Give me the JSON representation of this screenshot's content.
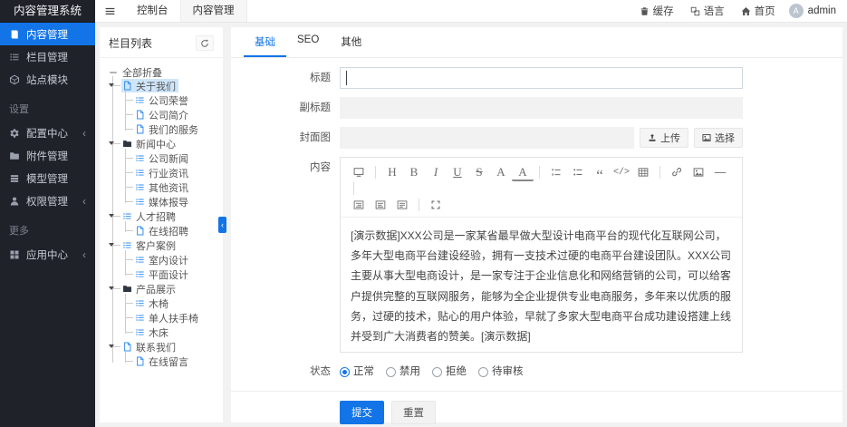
{
  "colors": {
    "primary": "#1274e7",
    "sidebar_bg": "#20222a",
    "tree_selected_bg": "#cfe6fa",
    "tree_icon_blue": "#2d8cf0",
    "folder_icon": "#2f3640"
  },
  "sidebar": {
    "title": "内容管理系统",
    "main_items": [
      {
        "label": "内容管理",
        "icon": "book",
        "active": true
      },
      {
        "label": "栏目管理",
        "icon": "list",
        "active": false
      },
      {
        "label": "站点模块",
        "icon": "cube",
        "active": false
      }
    ],
    "sections": [
      {
        "title": "设置",
        "items": [
          {
            "label": "配置中心",
            "icon": "gear",
            "chevron": true
          },
          {
            "label": "附件管理",
            "icon": "folder",
            "chevron": false
          },
          {
            "label": "模型管理",
            "icon": "layers",
            "chevron": false
          },
          {
            "label": "权限管理",
            "icon": "user",
            "chevron": true
          }
        ]
      },
      {
        "title": "更多",
        "items": [
          {
            "label": "应用中心",
            "icon": "grid",
            "chevron": true
          }
        ]
      }
    ]
  },
  "topbar": {
    "menu_icon": "menu",
    "tabs": [
      {
        "label": "控制台",
        "active": false
      },
      {
        "label": "内容管理",
        "active": true
      }
    ],
    "actions": [
      {
        "label": "缓存",
        "icon": "cache"
      },
      {
        "label": "语言",
        "icon": "language"
      },
      {
        "label": "首页",
        "icon": "home"
      }
    ],
    "user": {
      "name": "admin",
      "avatar_letter": "A"
    }
  },
  "tree": {
    "title": "栏目列表",
    "refresh_icon": "refresh",
    "collapse_all": "全部折叠",
    "collapse_handle": "‹",
    "nodes": [
      {
        "label": "关于我们",
        "icon": "file",
        "selected": true,
        "children": [
          {
            "label": "公司荣誉",
            "icon": "list"
          },
          {
            "label": "公司简介",
            "icon": "file"
          },
          {
            "label": "我们的服务",
            "icon": "file"
          }
        ]
      },
      {
        "label": "新闻中心",
        "icon": "folder",
        "children": [
          {
            "label": "公司新闻",
            "icon": "list"
          },
          {
            "label": "行业资讯",
            "icon": "list"
          },
          {
            "label": "其他资讯",
            "icon": "list"
          },
          {
            "label": "媒体报导",
            "icon": "list"
          }
        ]
      },
      {
        "label": "人才招聘",
        "icon": "list",
        "children": [
          {
            "label": "在线招聘",
            "icon": "file"
          }
        ]
      },
      {
        "label": "客户案例",
        "icon": "list",
        "children": [
          {
            "label": "室内设计",
            "icon": "list"
          },
          {
            "label": "平面设计",
            "icon": "list"
          }
        ]
      },
      {
        "label": "产品展示",
        "icon": "folder",
        "children": [
          {
            "label": "木椅",
            "icon": "list"
          },
          {
            "label": "单人扶手椅",
            "icon": "list"
          },
          {
            "label": "木床",
            "icon": "list"
          }
        ]
      },
      {
        "label": "联系我们",
        "icon": "file",
        "children": [
          {
            "label": "在线留言",
            "icon": "file"
          }
        ]
      }
    ]
  },
  "form": {
    "tabs": [
      {
        "label": "基础",
        "active": true
      },
      {
        "label": "SEO",
        "active": false
      },
      {
        "label": "其他",
        "active": false
      }
    ],
    "title_label": "标题",
    "title_value": "",
    "subtitle_label": "副标题",
    "cover_label": "封面图",
    "upload_button": "上传",
    "choose_button": "选择",
    "content_label": "内容",
    "content_text": "[演示数据]XXX公司是一家某省最早做大型设计电商平台的现代化互联网公司，多年大型电商平台建设经验，拥有一支技术过硬的电商平台建设团队。XXX公司主要从事大型电商设计，是一家专注于企业信息化和网络营销的公司，可以给客户提供完整的互联网服务，能够为全企业提供专业电商服务，多年来以优质的服务，过硬的技术，贴心的用户体验，早就了多家大型电商平台成功建设搭建上线并受到广大消费者的赞美。[演示数据]",
    "status_label": "状态",
    "status_options": [
      {
        "label": "正常",
        "selected": true
      },
      {
        "label": "禁用",
        "selected": false
      },
      {
        "label": "拒绝",
        "selected": false
      },
      {
        "label": "待审核",
        "selected": false
      }
    ],
    "submit_button": "提交",
    "reset_button": "重置"
  },
  "editor": {
    "toolbar_row1": [
      "preview",
      "divider",
      "heading",
      "bold",
      "italic",
      "underline",
      "strikethrough",
      "font",
      "font-color",
      "divider",
      "ordered-list",
      "unordered-list",
      "quote",
      "code",
      "table",
      "divider",
      "link",
      "image",
      "horizontal-rule",
      "divider"
    ],
    "toolbar_row2": [
      "indent",
      "outdent",
      "align-left",
      "divider",
      "fullscreen"
    ]
  }
}
